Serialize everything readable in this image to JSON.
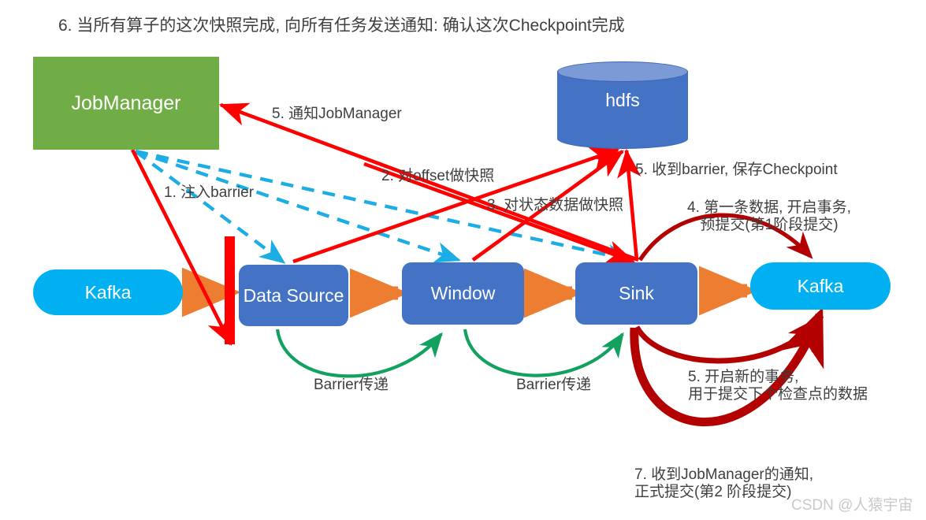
{
  "title": "6. 当所有算子的这次快照完成, 向所有任务发送通知: 确认这次Checkpoint完成",
  "nodes": {
    "jobmanager": "JobManager",
    "hdfs": "hdfs",
    "kafka_source": "Kafka",
    "kafka_sink": "Kafka",
    "data_source": "Data Source",
    "window": "Window",
    "sink": "Sink",
    "barrier_bar": "barrier"
  },
  "labels": {
    "step1_inject_barrier": "1. 注入barrier",
    "step2_offset_snapshot": "2. 对offset做快照",
    "step3_state_snapshot": "3. 对状态数据做快照",
    "step4_first_record_line1": "4. 第一条数据, 开启事务,",
    "step4_first_record_line2": "预提交(第1阶段提交)",
    "step5_notify_jobmanager": "5. 通知JobManager",
    "step5_recv_barrier": "5. 收到barrier, 保存Checkpoint",
    "step5_new_transaction_line1": "5. 开启新的事务,",
    "step5_new_transaction_line2": "用于提交下个检查点的数据",
    "step7_commit_line1": "7. 收到JobManager的通知,",
    "step7_commit_line2": "正式提交(第2 阶段提交)",
    "barrier_pass_1": "Barrier传递",
    "barrier_pass_2": "Barrier传递"
  },
  "watermark": "CSDN @人猿宇宙",
  "colors": {
    "jobmanager_green": "#70AD47",
    "operator_blue": "#4472C4",
    "kafka_cyan": "#00B0F0",
    "hdfs_top_blue": "#7C9BD6",
    "barrier_red": "#FF0000",
    "red_arrow": "#FF0000",
    "dashed_blue_arrow": "#1CADE4",
    "green_arrow": "#13A160",
    "orange_flow": "#ED7D31",
    "dark_red_arrow": "#B30000",
    "text_gray": "#3F3F3F",
    "watermark_gray": "#C9C9C9"
  }
}
